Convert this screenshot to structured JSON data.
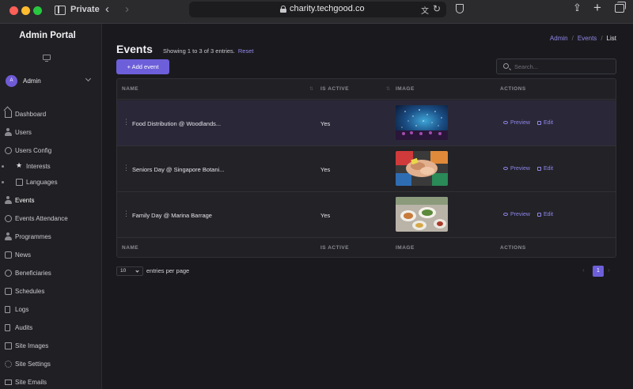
{
  "browser": {
    "mode_label": "Private",
    "url": "charity.techgood.co"
  },
  "sidebar": {
    "brand": "Admin Portal",
    "user": {
      "initial": "A",
      "name": "Admin"
    },
    "items": [
      {
        "label": "Dashboard",
        "icon": "home-icon"
      },
      {
        "label": "Users",
        "icon": "users-icon"
      },
      {
        "label": "Users Config",
        "icon": "users-config-icon"
      },
      {
        "label": "Interests",
        "icon": "star-icon"
      },
      {
        "label": "Languages",
        "icon": "language-icon"
      },
      {
        "label": "Events",
        "icon": "events-icon"
      },
      {
        "label": "Events Attendance",
        "icon": "attendance-icon"
      },
      {
        "label": "Programmes",
        "icon": "programmes-icon"
      },
      {
        "label": "News",
        "icon": "news-icon"
      },
      {
        "label": "Beneficiaries",
        "icon": "beneficiaries-icon"
      },
      {
        "label": "Schedules",
        "icon": "schedules-icon"
      },
      {
        "label": "Logs",
        "icon": "logs-icon"
      },
      {
        "label": "Audits",
        "icon": "audits-icon"
      },
      {
        "label": "Site Images",
        "icon": "image-icon"
      },
      {
        "label": "Site Settings",
        "icon": "gear-icon"
      },
      {
        "label": "Site Emails",
        "icon": "mail-icon"
      }
    ]
  },
  "breadcrumb": {
    "items": [
      "Admin",
      "Events"
    ],
    "current": "List"
  },
  "page": {
    "title": "Events",
    "subtitle": "Showing 1 to 3 of 3 entries.",
    "reset_label": "Reset",
    "add_button": "+ Add event",
    "search_placeholder": "Search..."
  },
  "table": {
    "columns": [
      "NAME",
      "IS ACTIVE",
      "IMAGE",
      "ACTIONS"
    ],
    "rows": [
      {
        "name": "Food Distribution @ Woodlands...",
        "active": "Yes",
        "preview": "Preview",
        "edit": "Edit"
      },
      {
        "name": "Seniors Day @ Singapore Botani...",
        "active": "Yes",
        "preview": "Preview",
        "edit": "Edit"
      },
      {
        "name": "Family Day @ Marina Barrage",
        "active": "Yes",
        "preview": "Preview",
        "edit": "Edit"
      }
    ]
  },
  "footer": {
    "per_page_value": "10",
    "per_page_label": "entries per page",
    "current_page": "1"
  },
  "colors": {
    "accent": "#6d5fd9",
    "link": "#8f86e8"
  }
}
